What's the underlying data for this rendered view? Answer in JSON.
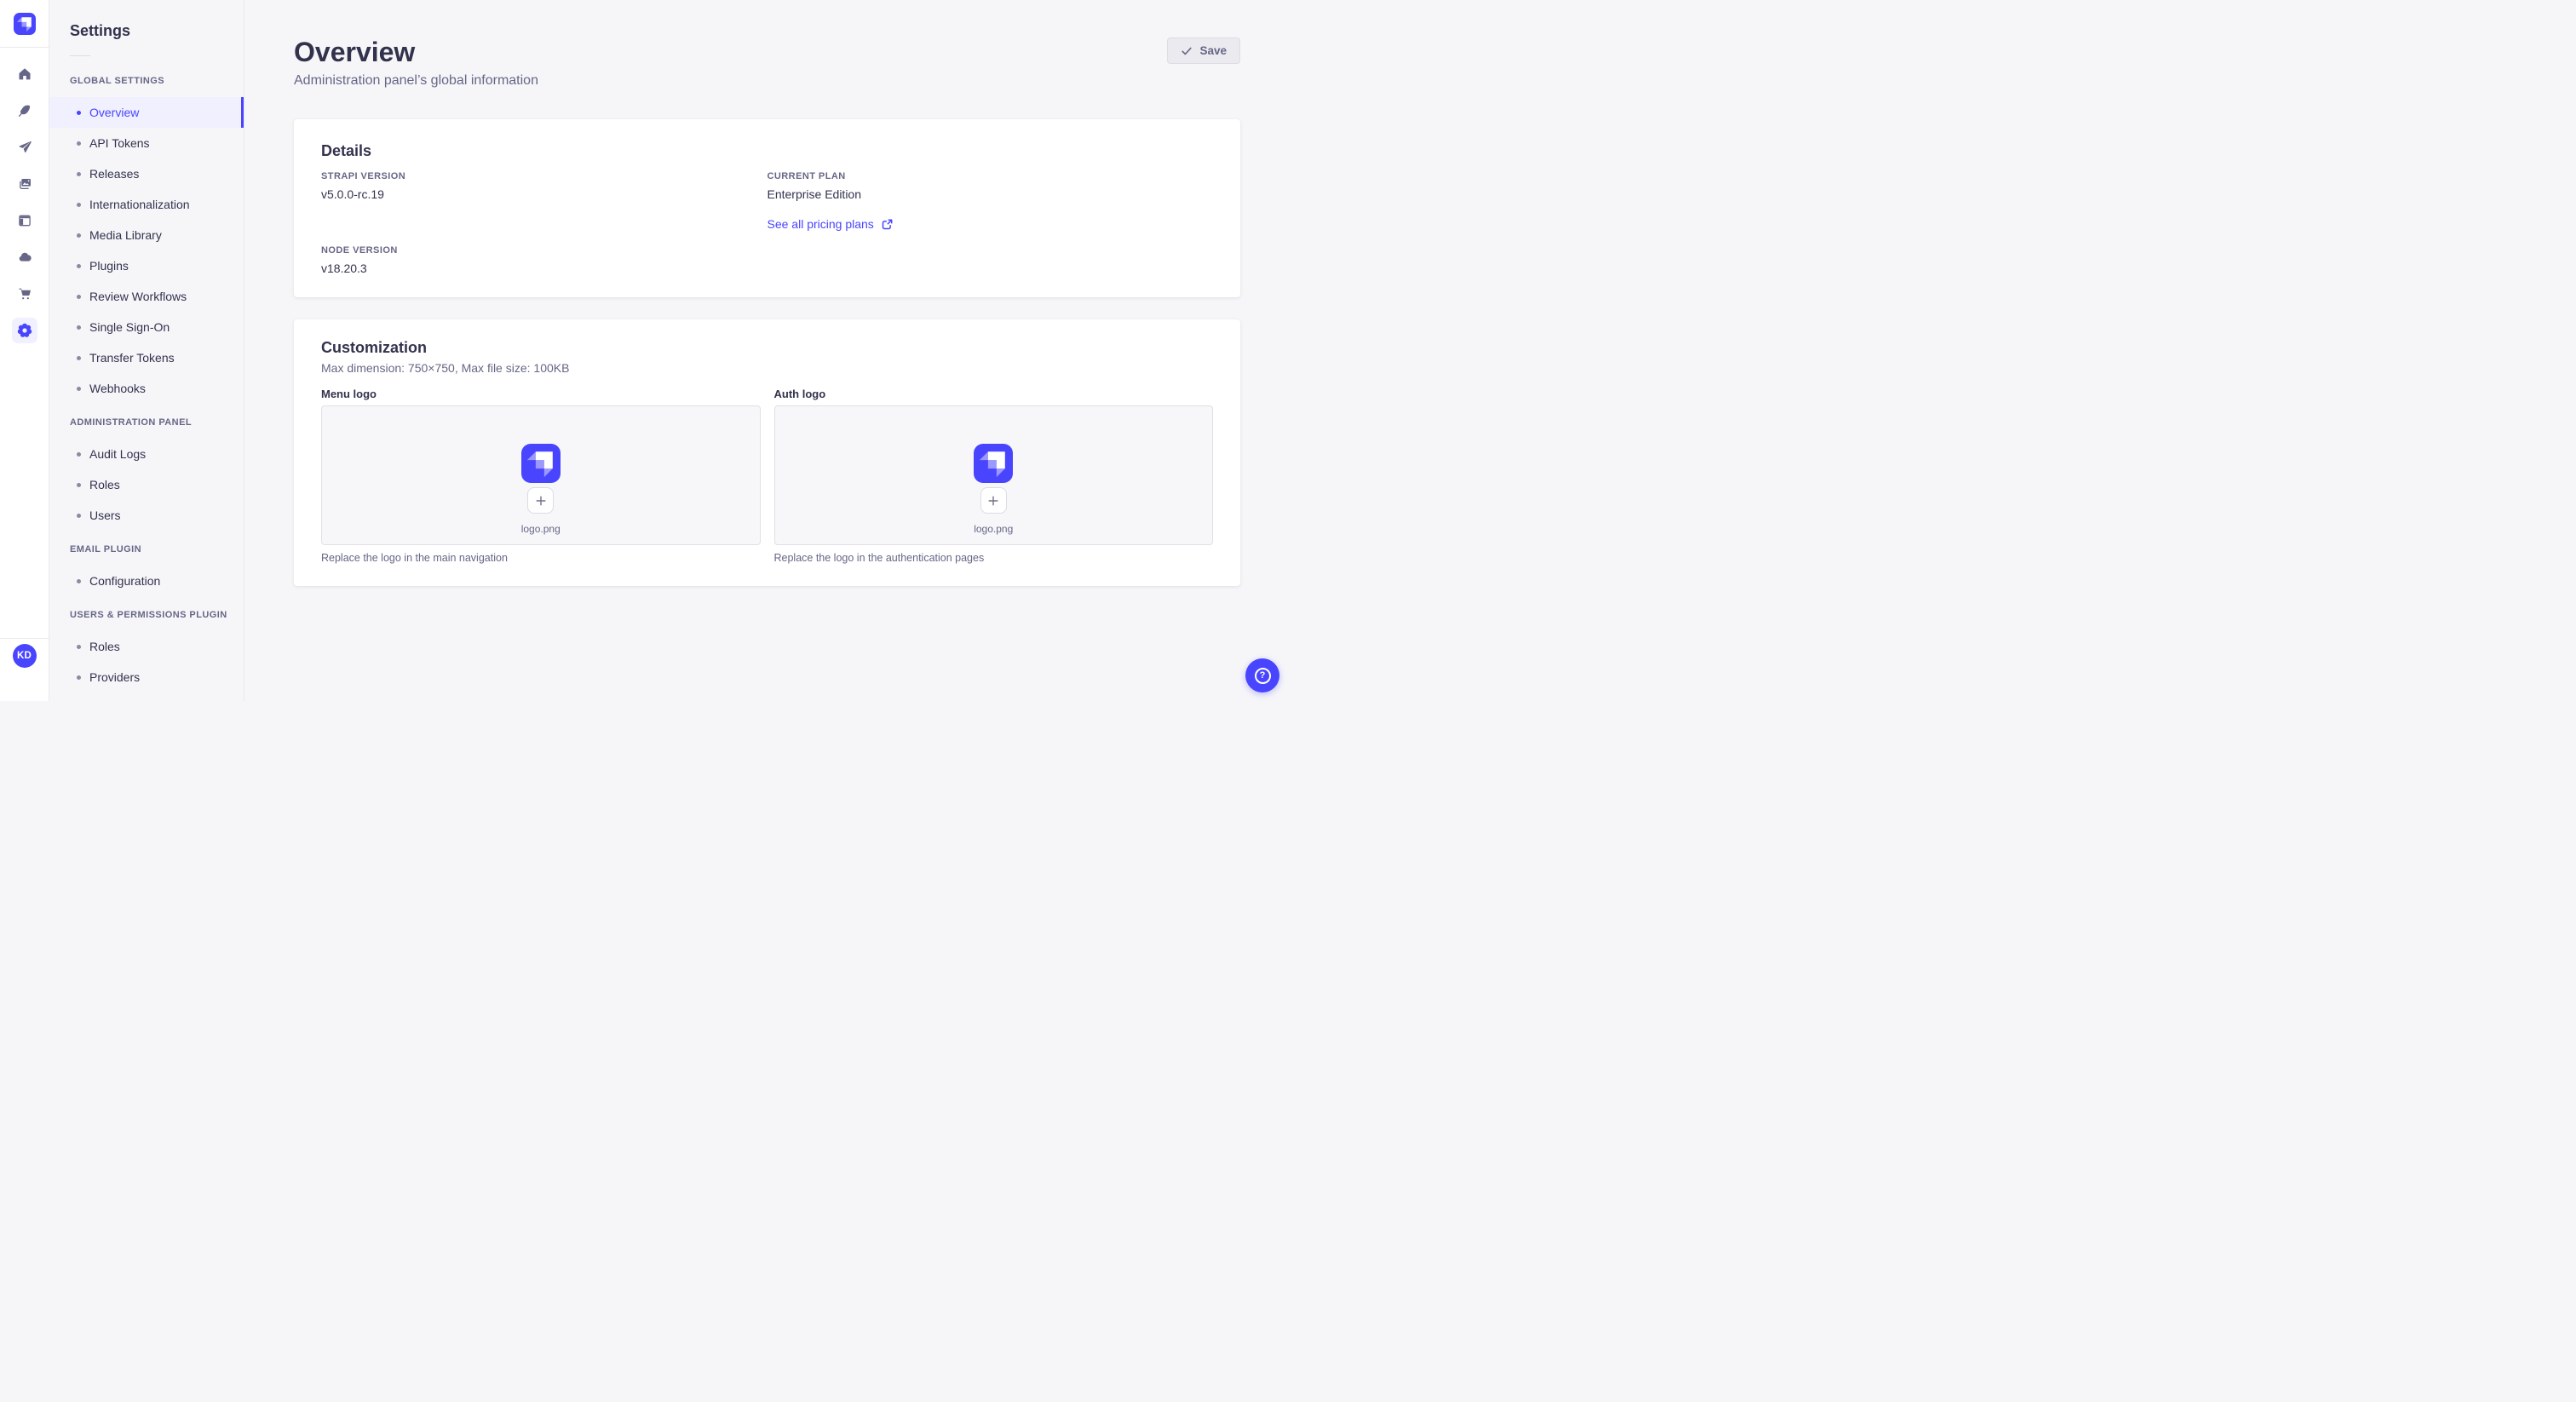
{
  "app": {
    "user_initials": "KD",
    "brand_icon": "strapi-logo-icon"
  },
  "rail": {
    "icons": [
      "home-icon",
      "content-feather-icon",
      "send-plane-icon",
      "media-images-icon",
      "layout-icon",
      "cloud-icon",
      "marketplace-cart-icon",
      "settings-gear-icon"
    ],
    "active_icon": "settings-gear-icon"
  },
  "nav": {
    "title": "Settings",
    "sections": [
      {
        "label": "GLOBAL SETTINGS",
        "items": [
          {
            "label": "Overview",
            "active": true
          },
          {
            "label": "API Tokens"
          },
          {
            "label": "Releases"
          },
          {
            "label": "Internationalization"
          },
          {
            "label": "Media Library"
          },
          {
            "label": "Plugins"
          },
          {
            "label": "Review Workflows"
          },
          {
            "label": "Single Sign-On"
          },
          {
            "label": "Transfer Tokens"
          },
          {
            "label": "Webhooks"
          }
        ]
      },
      {
        "label": "ADMINISTRATION PANEL",
        "items": [
          {
            "label": "Audit Logs"
          },
          {
            "label": "Roles"
          },
          {
            "label": "Users"
          }
        ]
      },
      {
        "label": "EMAIL PLUGIN",
        "items": [
          {
            "label": "Configuration"
          }
        ]
      },
      {
        "label": "USERS & PERMISSIONS PLUGIN",
        "items": [
          {
            "label": "Roles"
          },
          {
            "label": "Providers"
          }
        ]
      }
    ]
  },
  "header": {
    "title": "Overview",
    "subtitle": "Administration panel’s global information",
    "save_label": "Save",
    "save_icon": "check-icon"
  },
  "details": {
    "heading": "Details",
    "strapi_version": {
      "label": "STRAPI VERSION",
      "value": "v5.0.0-rc.19"
    },
    "current_plan": {
      "label": "CURRENT PLAN",
      "value": "Enterprise Edition"
    },
    "pricing_link": {
      "label": "See all pricing plans",
      "icon": "external-link-icon"
    },
    "node_version": {
      "label": "NODE VERSION",
      "value": "v18.20.3"
    }
  },
  "customization": {
    "heading": "Customization",
    "constraints": "Max dimension: 750×750, Max file size: 100KB",
    "menu_logo": {
      "label": "Menu logo",
      "filename": "logo.png",
      "help": "Replace the logo in the main navigation"
    },
    "auth_logo": {
      "label": "Auth logo",
      "filename": "logo.png",
      "help": "Replace the logo in the authentication pages"
    }
  },
  "help": {
    "icon": "question-mark-icon"
  },
  "colors": {
    "accent": "#4945FF",
    "text": "#32324D",
    "subtext": "#666687",
    "background": "#F6F6F9",
    "card": "#FFFFFF",
    "active_item_bg": "#F0F0FF",
    "border": "#EAEAEF",
    "disabled_button_bg": "#EAEAEF"
  }
}
